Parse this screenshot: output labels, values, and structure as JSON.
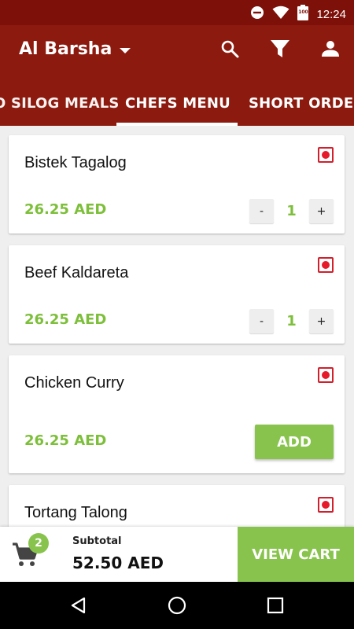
{
  "status": {
    "time": "12:24",
    "battery": "100"
  },
  "header": {
    "location": "Al Barsha"
  },
  "tabs": [
    {
      "label": "O SILOG MEALS"
    },
    {
      "label": "CHEFS MENU"
    },
    {
      "label": "SHORT ORDER"
    }
  ],
  "items": [
    {
      "name": "Bistek Tagalog",
      "price": "26.25 AED",
      "qty": "1"
    },
    {
      "name": "Beef Kaldareta",
      "price": "26.25 AED",
      "qty": "1"
    },
    {
      "name": "Chicken Curry",
      "price": "26.25 AED",
      "action": "ADD"
    },
    {
      "name": "Tortang Talong"
    }
  ],
  "controls": {
    "minus": "-",
    "plus": "+"
  },
  "cart": {
    "count": "2",
    "subtotal_label": "Subtotal",
    "subtotal_value": "52.50 AED",
    "view_cart": "VIEW CART"
  },
  "colors": {
    "primary": "#8c1a0f",
    "accent": "#88c44d",
    "price": "#7dbf3a",
    "nonveg": "#e6192b"
  },
  "icons": [
    "do-not-disturb-icon",
    "wifi-icon",
    "battery-icon",
    "dropdown-arrow-icon",
    "search-icon",
    "filter-icon",
    "account-icon",
    "cart-icon",
    "back-icon",
    "home-icon",
    "recents-icon"
  ]
}
